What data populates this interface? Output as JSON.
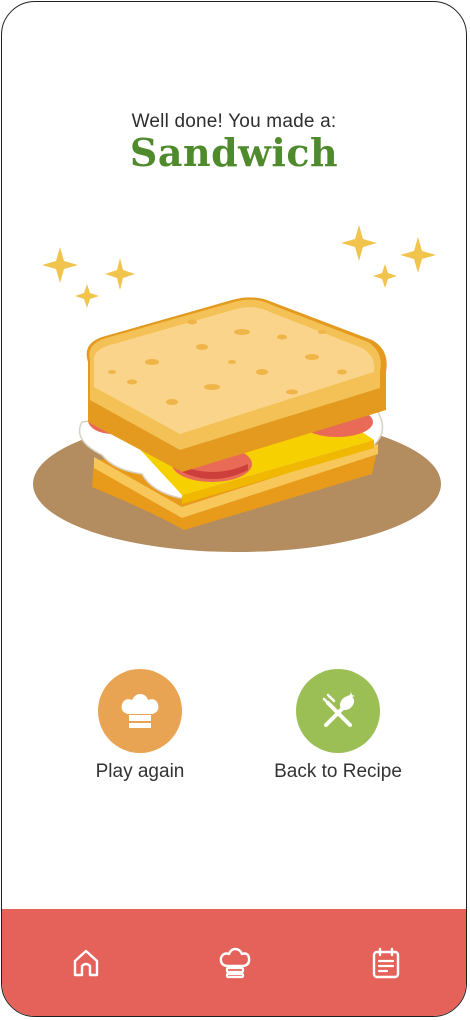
{
  "result": {
    "subtitle": "Well done! You made a:",
    "dish_name": "Sandwich",
    "dish_color": "#4f8a2c",
    "illustration": "sandwich-illustration"
  },
  "actions": {
    "play_again": {
      "label": "Play again",
      "icon": "chef-hat-icon",
      "color": "#e8a452"
    },
    "back_to_recipe": {
      "label": "Back to Recipe",
      "icon": "utensils-icon",
      "color": "#9cbf55"
    }
  },
  "nav": {
    "background": "#e4625a",
    "items": [
      {
        "icon": "home-icon"
      },
      {
        "icon": "chef-hat-icon"
      },
      {
        "icon": "calendar-icon"
      }
    ]
  }
}
